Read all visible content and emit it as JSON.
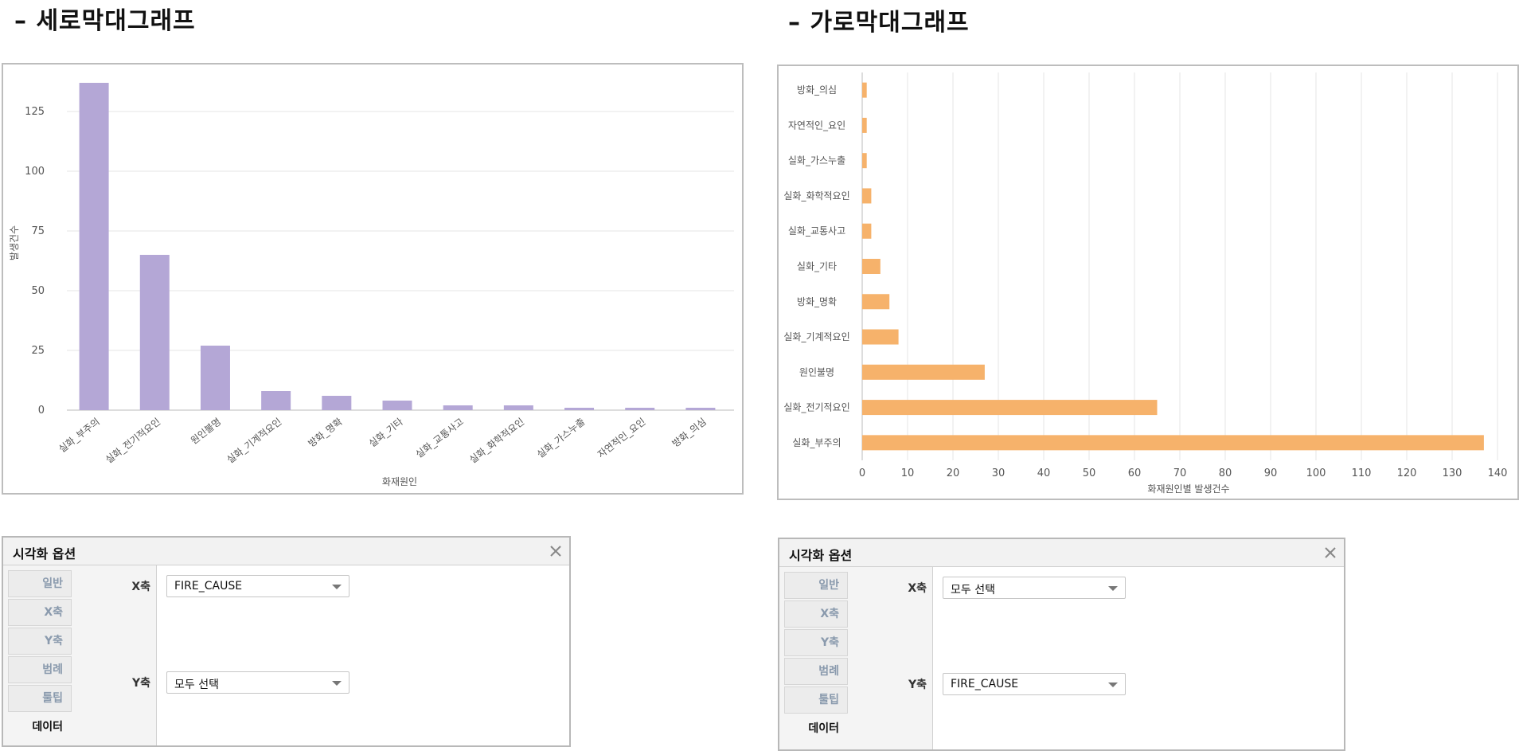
{
  "left": {
    "title": "– 세로막대그래프",
    "options": {
      "title": "시각화 옵션",
      "tabs": [
        "일반",
        "X축",
        "Y축",
        "범례",
        "툴팁",
        "데이터"
      ],
      "active_tab": 5,
      "x_label": "X축",
      "x_value": "FIRE_CAUSE",
      "y_label": "Y축",
      "y_value": "모두 선택"
    }
  },
  "right": {
    "title": "– 가로막대그래프",
    "options": {
      "title": "시각화 옵션",
      "tabs": [
        "일반",
        "X축",
        "Y축",
        "범례",
        "툴팁",
        "데이터"
      ],
      "active_tab": 5,
      "x_label": "X축",
      "x_value": "모두 선택",
      "y_label": "Y축",
      "y_value": "FIRE_CAUSE"
    }
  },
  "chart_data": [
    {
      "type": "bar",
      "orientation": "vertical",
      "categories": [
        "실화_부주의",
        "실화_전기적요인",
        "원인불명",
        "실화_기계적요인",
        "방화_명확",
        "실화_기타",
        "실화_교통사고",
        "실화_화학적요인",
        "실화_가스누출",
        "자연적인_요인",
        "방화_의심"
      ],
      "values": [
        137,
        65,
        27,
        8,
        6,
        4,
        2,
        2,
        1,
        1,
        1
      ],
      "xlabel": "화재원인",
      "ylabel": "발생건수",
      "ylim": [
        0,
        140
      ],
      "yticks": [
        0,
        25,
        50,
        75,
        100,
        125
      ],
      "grid": "horizontal",
      "color": "#b4a7d6"
    },
    {
      "type": "bar",
      "orientation": "horizontal",
      "categories": [
        "방화_의심",
        "자연적인_요인",
        "실화_가스누출",
        "실화_화학적요인",
        "실화_교통사고",
        "실화_기타",
        "방화_명확",
        "실화_기계적요인",
        "원인불명",
        "실화_전기적요인",
        "실화_부주의"
      ],
      "values": [
        1,
        1,
        1,
        2,
        2,
        4,
        6,
        8,
        27,
        65,
        137
      ],
      "xlabel": "화재원인별 발생건수",
      "xlim": [
        0,
        140
      ],
      "xticks": [
        0,
        10,
        20,
        30,
        40,
        50,
        60,
        70,
        80,
        90,
        100,
        110,
        120,
        130,
        140
      ],
      "grid": "vertical",
      "color": "#f6b26b"
    }
  ]
}
